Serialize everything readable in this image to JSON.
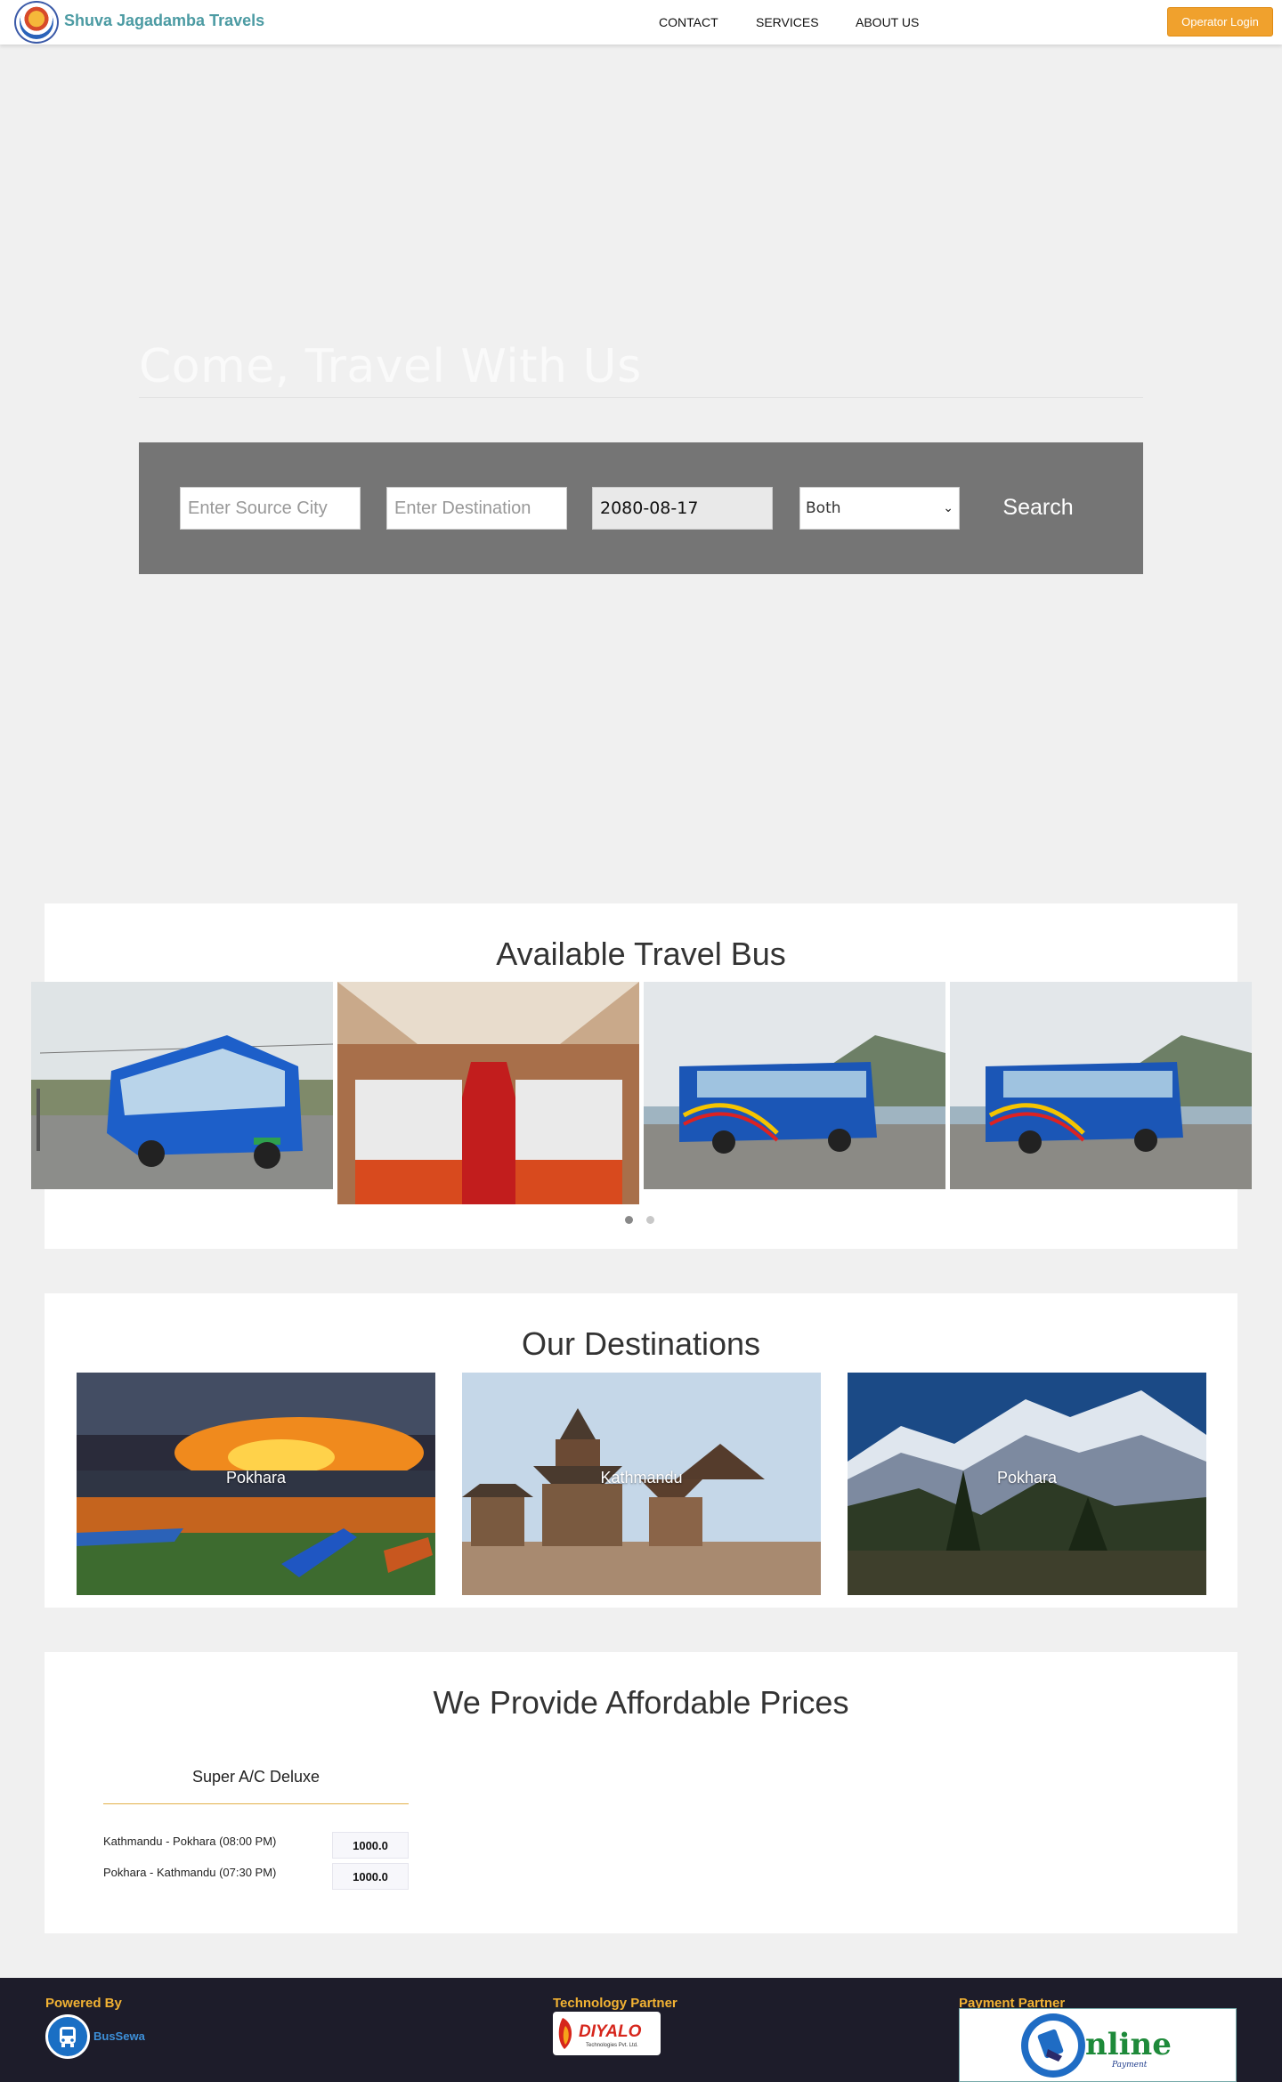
{
  "header": {
    "brand": "Shuva Jagadamba Travels",
    "nav": [
      "CONTACT",
      "SERVICES",
      "ABOUT US"
    ],
    "operator_login": "Operator Login"
  },
  "hero": {
    "title": "Come, Travel With Us",
    "search": {
      "source_placeholder": "Enter Source City",
      "destination_placeholder": "Enter Destination",
      "date_value": "2080-08-17",
      "trip_type": "Both",
      "search_label": "Search"
    }
  },
  "buses": {
    "title": "Available Travel Bus",
    "slides_total": 2,
    "active_slide": 1
  },
  "destinations": {
    "title": "Our Destinations",
    "items": [
      {
        "label": "Pokhara"
      },
      {
        "label": "Kathmandu"
      },
      {
        "label": "Pokhara"
      }
    ]
  },
  "prices": {
    "title": "We Provide Affordable Prices",
    "card_title": "Super A/C Deluxe",
    "rows": [
      {
        "route": "Kathmandu - Pokhara (08:00 PM)",
        "price": "1000.0"
      },
      {
        "route": "Pokhara - Kathmandu (07:30 PM)",
        "price": "1000.0"
      }
    ]
  },
  "footer": {
    "powered_by": "Powered By",
    "powered_name": "BusSewa",
    "tech_partner": "Technology Partner",
    "tech_partner_logo": "DIYALO",
    "tech_partner_sub": "Technologies Pvt. Ltd.",
    "payment_partner": "Payment Partner",
    "payment_logo": "nline",
    "payment_sub": "Payment"
  },
  "colors": {
    "brand": "#4c9ba3",
    "accent": "#f0a12d",
    "footer_bg": "#1d1c2a",
    "footer_heading": "#f2b233"
  }
}
